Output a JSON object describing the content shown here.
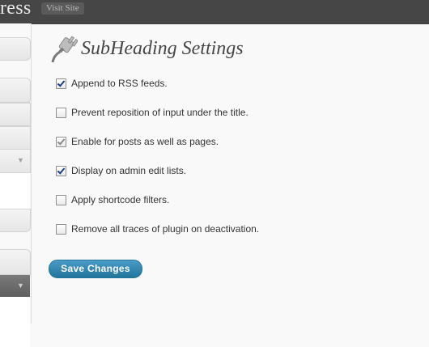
{
  "header": {
    "brand_text": "ress",
    "visit_site_label": "Visit Site"
  },
  "page": {
    "title": "SubHeading Settings",
    "icon": "plug-icon"
  },
  "options": [
    {
      "label": "Append to RSS feeds.",
      "checked": true
    },
    {
      "label": "Prevent reposition of input under the title.",
      "checked": false
    },
    {
      "label": "Enable for posts as well as pages.",
      "checked": true
    },
    {
      "label": "Display on admin edit lists.",
      "checked": true
    },
    {
      "label": "Apply shortcode filters.",
      "checked": false
    },
    {
      "label": "Remove all traces of plugin on deactivation.",
      "checked": false
    }
  ],
  "actions": {
    "save_label": "Save Changes"
  },
  "sidebar": {
    "toggle_icon": "triangle-down-icon"
  },
  "colors": {
    "header_bg": "#464646",
    "button_blue": "#21759b",
    "title_color": "#464646"
  }
}
